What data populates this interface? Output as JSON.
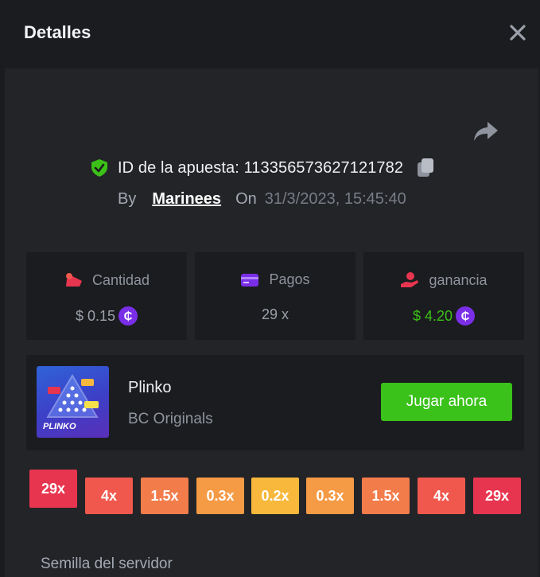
{
  "header": {
    "title": "Detalles"
  },
  "bet": {
    "id_label": "ID de la apuesta: 113356573627121782",
    "by_label": "By",
    "user": "Marinees",
    "on_label": "On",
    "datetime": "31/3/2023, 15:45:40"
  },
  "stats": [
    {
      "label": "Cantidad",
      "value": "$ 0.15",
      "icon": "bet-amount-icon",
      "coin": "₵"
    },
    {
      "label": "Pagos",
      "value": "29 x",
      "icon": "card-icon"
    },
    {
      "label": "ganancia",
      "value": "$ 4.20",
      "icon": "profit-hand-icon",
      "coin": "₵"
    }
  ],
  "game": {
    "thumb_label": "PLINKO",
    "name": "Plinko",
    "provider": "BC Originals",
    "play_label": "Jugar ahora"
  },
  "multipliers": [
    {
      "label": "29x",
      "color": "#e8354f",
      "active": true
    },
    {
      "label": "4x",
      "color": "#f0584d"
    },
    {
      "label": "1.5x",
      "color": "#f37c4b"
    },
    {
      "label": "0.3x",
      "color": "#f59a45"
    },
    {
      "label": "0.2x",
      "color": "#f8b83c"
    },
    {
      "label": "0.3x",
      "color": "#f59a45"
    },
    {
      "label": "1.5x",
      "color": "#f37c4b"
    },
    {
      "label": "4x",
      "color": "#f0584d"
    },
    {
      "label": "29x",
      "color": "#e8354f"
    }
  ],
  "seed": {
    "label": "Semilla del servidor"
  },
  "colors": {
    "accent_green": "#3ac11a",
    "coin_purple": "#7a2ee8",
    "background": "#232428"
  }
}
